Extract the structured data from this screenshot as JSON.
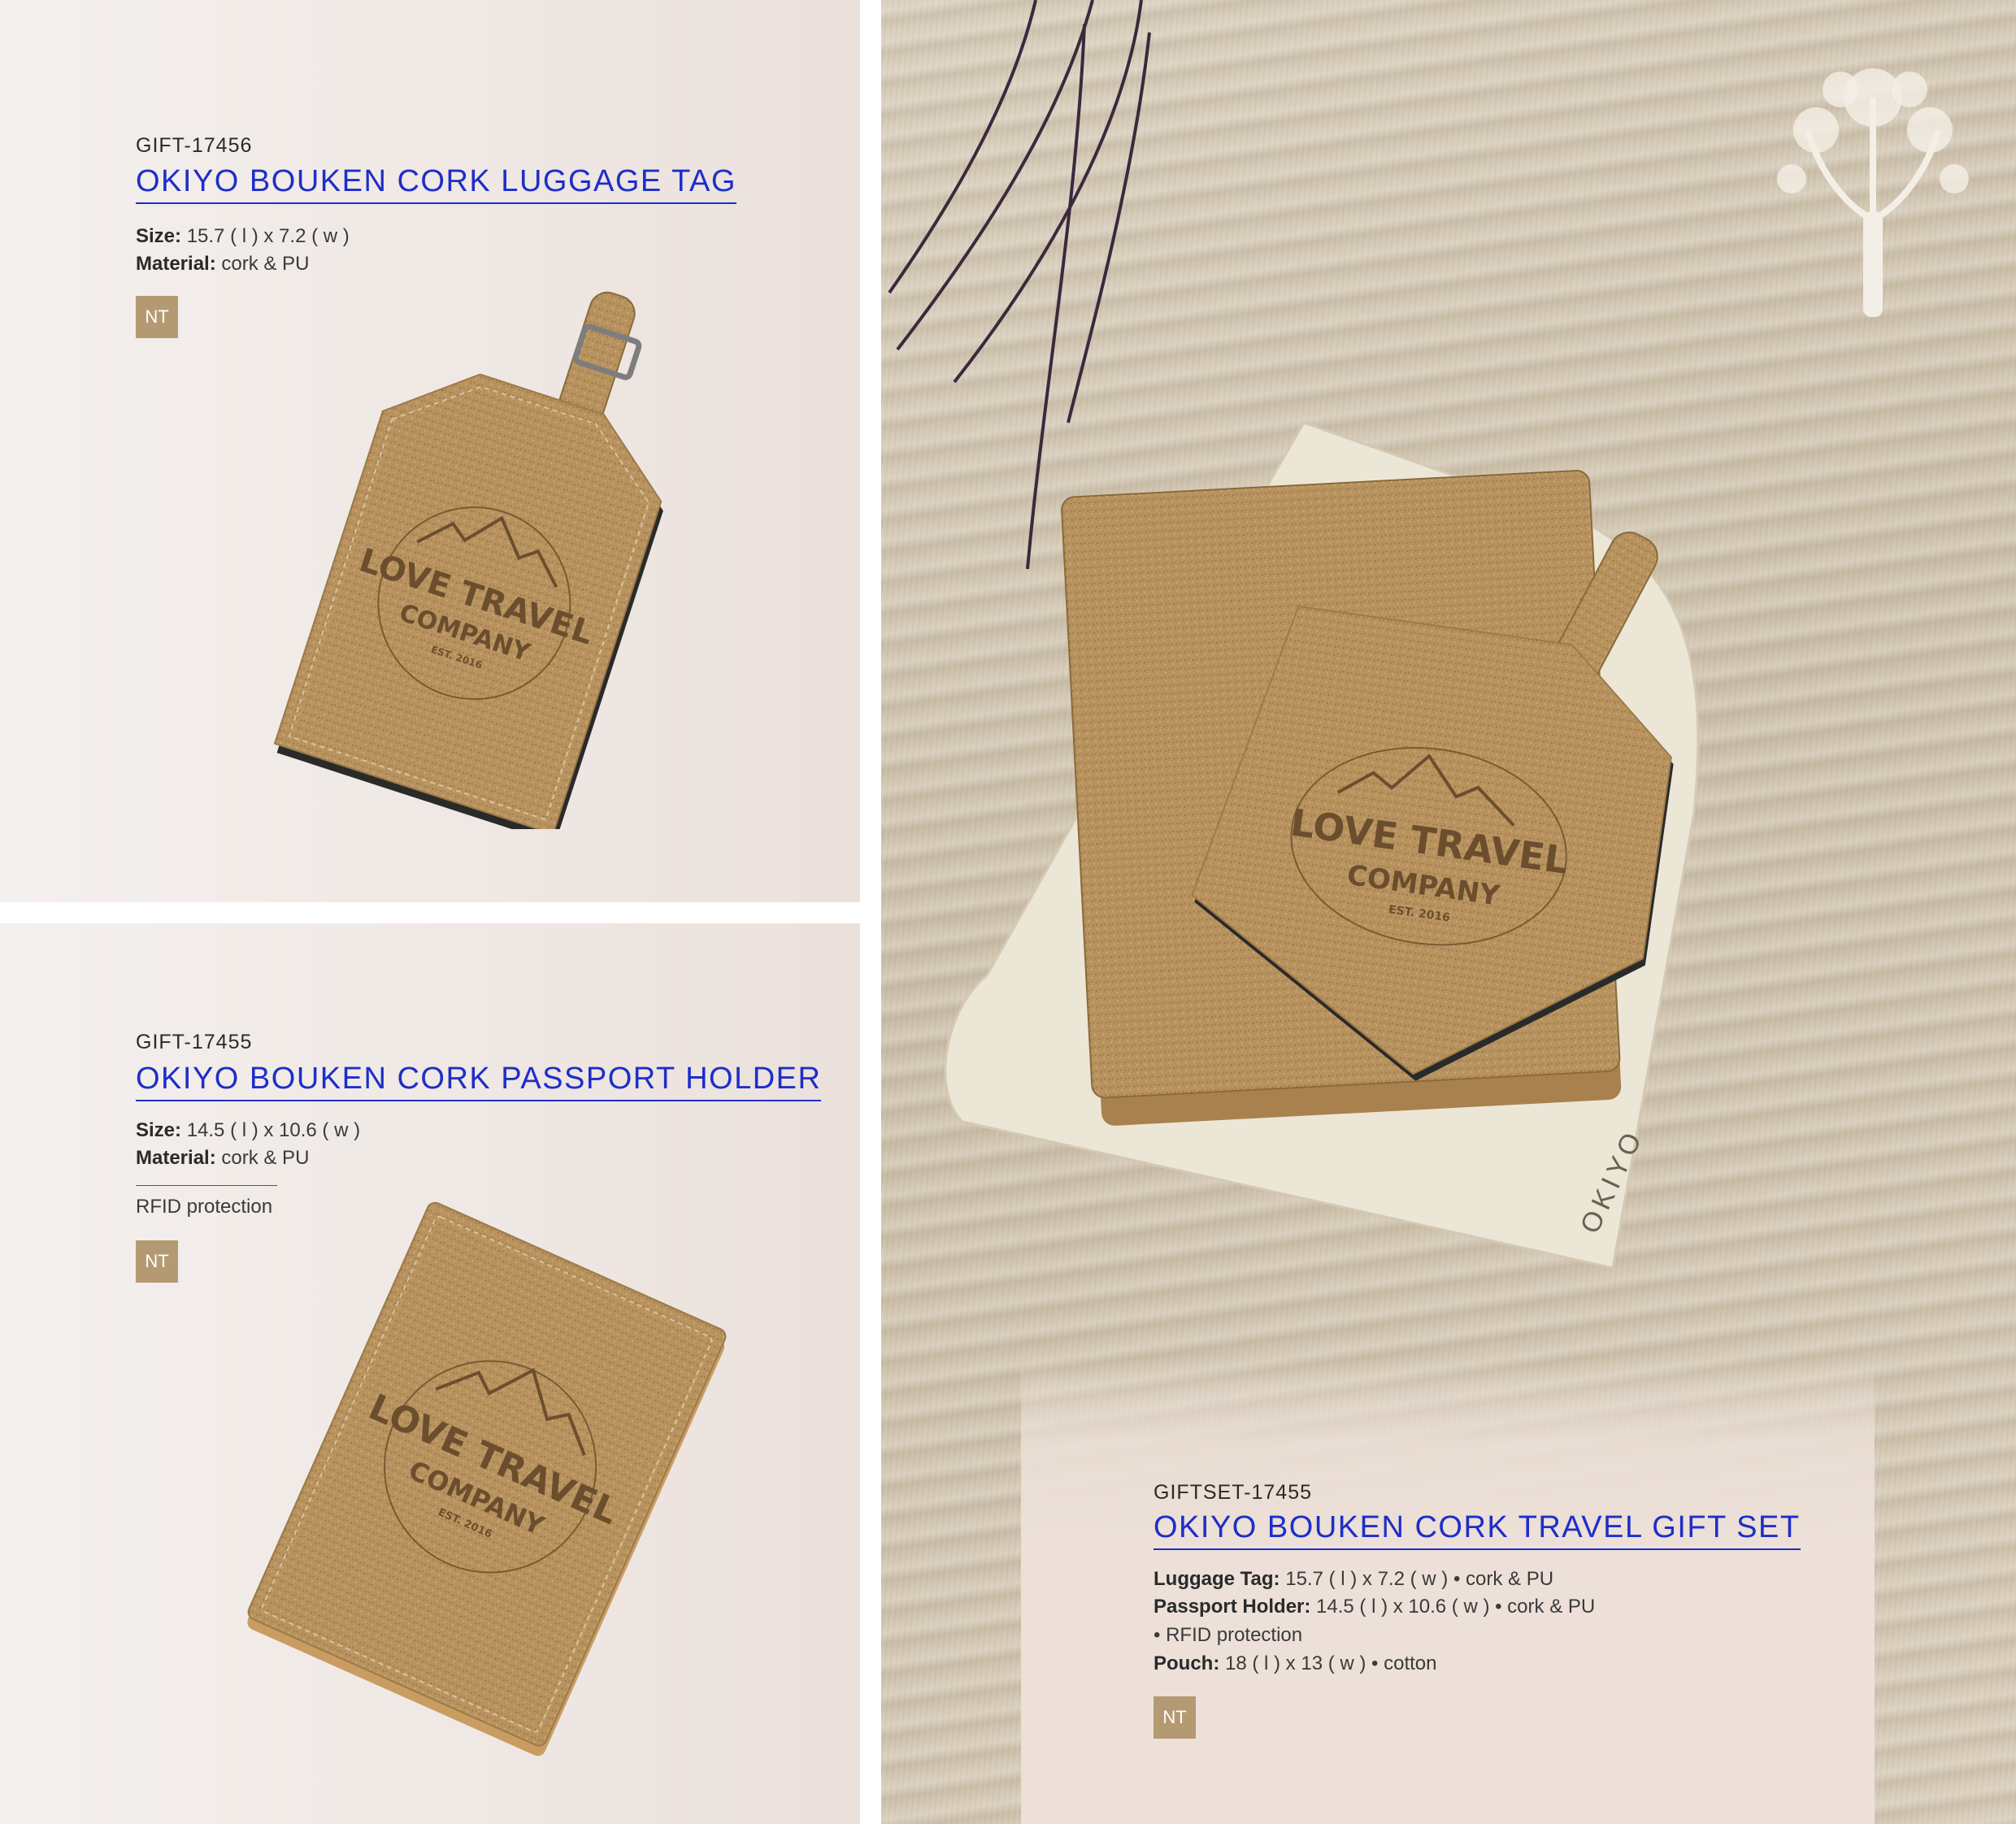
{
  "luggage_tag": {
    "code": "GIFT-17456",
    "title": "OKIYO BOUKEN CORK LUGGAGE TAG",
    "size_label": "Size:",
    "size_value": "15.7 ( l ) x 7.2 ( w )",
    "material_label": "Material:",
    "material_value": "cork & PU",
    "badge": "NT",
    "engraving": {
      "line1": "LOVE TRAVEL",
      "line2": "COMPANY",
      "line3": "EST. 2016"
    }
  },
  "passport_holder": {
    "code": "GIFT-17455",
    "title": "OKIYO BOUKEN CORK PASSPORT HOLDER",
    "size_label": "Size:",
    "size_value": "14.5 ( l ) x 10.6 ( w )",
    "material_label": "Material:",
    "material_value": "cork & PU",
    "feature": "RFID protection",
    "badge": "NT",
    "engraving": {
      "line1": "LOVE TRAVEL",
      "line2": "COMPANY",
      "line3": "EST. 2016"
    }
  },
  "gift_set": {
    "code": "GIFTSET-17455",
    "title": "OKIYO BOUKEN CORK TRAVEL GIFT SET",
    "luggage_label": "Luggage Tag:",
    "luggage_value": "15.7 ( l ) x 7.2 ( w )  •  cork & PU",
    "passport_label": "Passport Holder:",
    "passport_value": "14.5 ( l ) x 10.6 ( w )  •  cork & PU",
    "passport_extra": "•  RFID protection",
    "pouch_label": "Pouch:",
    "pouch_value": "18 ( l ) x 13 ( w )  •  cotton",
    "badge": "NT",
    "pouch_brand": "OKIYO",
    "engraving": {
      "line1": "LOVE TRAVEL",
      "line2": "COMPANY",
      "line3": "EST. 2016"
    }
  },
  "colors": {
    "title_blue": "#1e2ec8",
    "badge_tan": "#b49a73",
    "cork": "#b8935f"
  }
}
